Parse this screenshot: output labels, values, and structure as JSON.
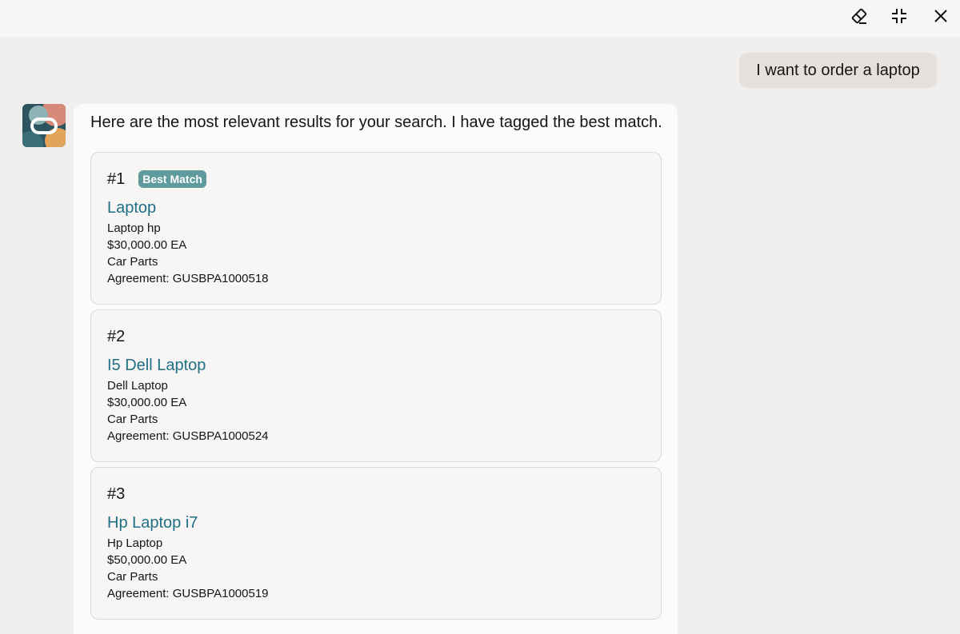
{
  "toolbar": {
    "clear_icon": "eraser-icon",
    "collapse_icon": "collapse-icon",
    "close_icon": "close-icon"
  },
  "user_message": "I want to order a laptop",
  "bot": {
    "avatar_icon": "oracle-assistant-logo",
    "intro": "Here are the most relevant results for your search. I have tagged the best match.",
    "results": [
      {
        "rank": "#1",
        "badge": "Best Match",
        "title": "Laptop",
        "description": "Laptop hp",
        "price": "$30,000.00 EA",
        "category": "Car Parts",
        "agreement": "Agreement: GUSBPA1000518"
      },
      {
        "rank": "#2",
        "title": "I5 Dell Laptop",
        "description": "Dell Laptop",
        "price": "$30,000.00 EA",
        "category": "Car Parts",
        "agreement": "Agreement: GUSBPA1000524"
      },
      {
        "rank": "#3",
        "title": "Hp Laptop i7",
        "description": "Hp Laptop",
        "price": "$50,000.00 EA",
        "category": "Car Parts",
        "agreement": "Agreement: GUSBPA1000519"
      }
    ]
  },
  "colors": {
    "accent_link": "#1f6f86",
    "badge_bg": "#5f9a9c",
    "user_bubble_bg": "#e4e1dd"
  }
}
